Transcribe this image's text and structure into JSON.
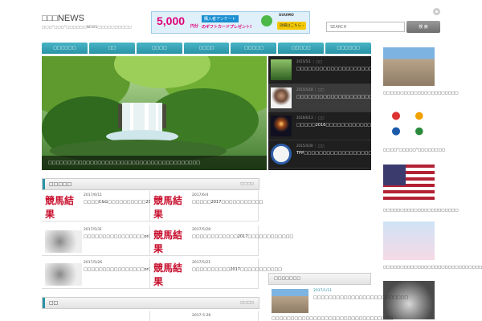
{
  "header": {
    "site_title": "□□□NEWS",
    "site_description": "□□□“□□□”□□□□□□NEWS□□□□□□□□□□",
    "search_placeholder": "SEARCH",
    "search_button": "検 索"
  },
  "banner": {
    "amount": "5,000",
    "unit": "円分",
    "line1": "購入者アンケート",
    "line2": "のギフトカードプレゼント!",
    "brand": "SUUMO",
    "cta": "詳細はこちら ›"
  },
  "nav": {
    "items": [
      "□□□□□□",
      "□□",
      "□□□□",
      "□□□□",
      "□□□□□",
      "□□□□□",
      "□□□□□□"
    ]
  },
  "slider": {
    "caption": "□□□□□□□□□□□□□□□□□□□□□□□□□□□□□□□□□□□□□□□□",
    "items": [
      {
        "date": "2015/5/1 ｜ □□",
        "title": "□□□□□□□□□□□□□□□□□□□□□□□□□□□□□□□□□□□"
      },
      {
        "date": "2015/5/18 ｜ □□",
        "title": "□□□□□□□□□□□□□□□□□□□□□□□□□□□□..."
      },
      {
        "date": "2016/6/13 ｜ □□",
        "title": "□□□□□2016□□□□□□□□□□□□□□□□□□□"
      },
      {
        "date": "2015/4/30 ｜ □□",
        "title": "TPP□□□□□□□□□□□□□□□□□□□□□□□□□□□□□□..."
      }
    ]
  },
  "sidebar": {
    "items": [
      {
        "title": "□□□□□□□□□□□□□□□□□□□□□□"
      },
      {
        "title": "□□□□“□□□□□”□□□□□□□□"
      },
      {
        "title": "□□□□□□□□□□□□□□□□□□□□□□"
      },
      {
        "title": "□□□□□□□□□□□□□□□□□□□□□□□□□□□□□"
      }
    ]
  },
  "box1": {
    "title": "□□□□□",
    "more": "□□□□",
    "cells": [
      {
        "date": "2017/6/11",
        "title": "□□□□C&G□□□□□□□□□□2017□□□□□□□□□",
        "thumb_text": "競馬結果"
      },
      {
        "date": "2017/6/4",
        "title": "□□□□□2017□□□□□□□□□□□",
        "thumb_text": "競馬結果"
      },
      {
        "date": "2017/5/31",
        "title": "□□□□□□□□□□□□□□□□or□□□□□□□□□□□□□□□□□□",
        "thumb_text": ""
      },
      {
        "date": "2017/5/28",
        "title": "□□□□□□□□□□□□2017□□□□□□□□□□□□",
        "thumb_text": "競馬結果"
      },
      {
        "date": "2017/5/26",
        "title": "□□□□□□□□□□□□□□□□or□□□□□□□□□□□□□□□□",
        "thumb_text": ""
      },
      {
        "date": "2017/5/21",
        "title": "□□□□□□□□□□2017□□□□□□□□□□□",
        "thumb_text": "競馬結果"
      }
    ]
  },
  "box2": {
    "title": "□□",
    "more": "□□□□",
    "cells": [
      {
        "date": "",
        "title": ""
      },
      {
        "date": "2017-5-26",
        "title": ""
      }
    ]
  },
  "popular": {
    "title": "□□□□□□□",
    "date": "2017/1/11",
    "item_title": "□□□□□□□□□□□□□□□□□□□□□□□□□",
    "next_title": "□□□□□□□□□□□□□□□□□□□□□□□□□□□□□□□□"
  },
  "colors": {
    "accent": "#2a93a6",
    "keiba_red": "#c8102e",
    "slider_bg": "#1f1f1f"
  }
}
